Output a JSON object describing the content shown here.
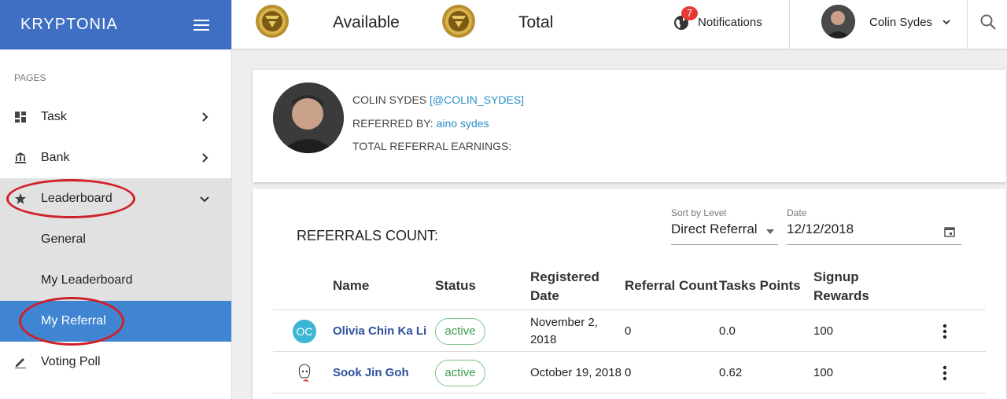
{
  "sidebar": {
    "brand": "KRYPTONIA",
    "section": "PAGES",
    "items": [
      {
        "label": "Task"
      },
      {
        "label": "Bank"
      },
      {
        "label": "Leaderboard"
      },
      {
        "label": "General"
      },
      {
        "label": "My Leaderboard"
      },
      {
        "label": "My Referral"
      },
      {
        "label": "Voting Poll"
      }
    ]
  },
  "topbar": {
    "available_label": "Available",
    "total_label": "Total",
    "notifications_label": "Notifications",
    "notifications_badge": "7",
    "user_name": "Colin Sydes"
  },
  "profile": {
    "name": "COLIN SYDES",
    "handle": "[@COLIN_SYDES]",
    "referred_by_label": "REFERRED BY:",
    "referred_by": "aino sydes",
    "earnings_label": "TOTAL REFERRAL EARNINGS:"
  },
  "referrals": {
    "title": "REFERRALS COUNT:",
    "sort_label": "Sort by Level",
    "sort_value": "Direct Referral",
    "date_label": "Date",
    "date_value": "12/12/2018",
    "headers": {
      "name": "Name",
      "status": "Status",
      "registered_1": "Registered",
      "registered_2": "Date",
      "referral_count": "Referral Count",
      "tasks_points": "Tasks Points",
      "signup_1": "Signup",
      "signup_2": "Rewards"
    },
    "rows": [
      {
        "initials": "OC",
        "name": "Olivia Chin Ka Li",
        "status": "active",
        "date_1": "November 2,",
        "date_2": "2018",
        "referral_count": "0",
        "tasks_points": "0.0",
        "signup_rewards": "100"
      },
      {
        "initials": "",
        "name": "Sook Jin Goh",
        "status": "active",
        "date_1": "October 19, 2018",
        "date_2": "",
        "referral_count": "0",
        "tasks_points": "0.62",
        "signup_rewards": "100"
      }
    ]
  },
  "colors": {
    "brand": "#3f6fc3",
    "active_nav": "#3f85d1",
    "highlight_oval": "#d0202a",
    "status_green": "#3c9c4a",
    "link": "#2a8ec9"
  },
  "icons": [
    "hamburger-icon",
    "dashboard-icon",
    "bank-icon",
    "star-icon",
    "pencil-icon",
    "chevron-right-icon",
    "chevron-down-icon",
    "coin-icon",
    "globe-icon",
    "search-icon",
    "calendar-icon",
    "more-vert-icon"
  ]
}
